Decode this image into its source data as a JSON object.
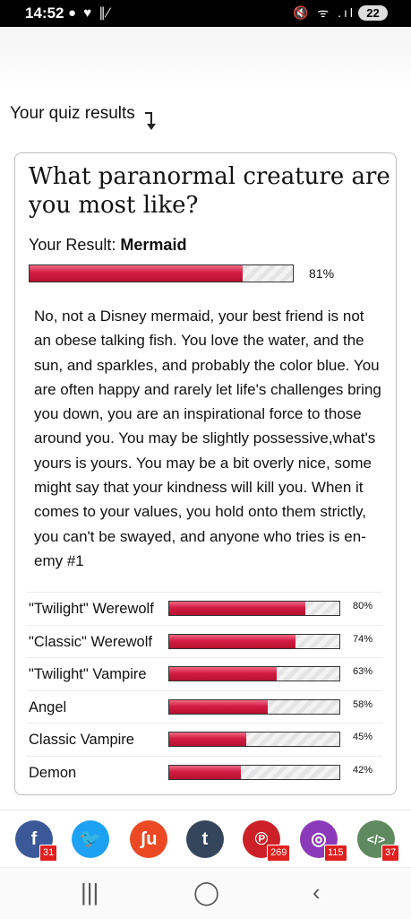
{
  "status": {
    "time": "14:52",
    "left_icons": "● ♥ ∥∕",
    "right_icons": "🔇 ᯤ .ıl",
    "battery": "22"
  },
  "page": {
    "results_label": "Your quiz results"
  },
  "quiz": {
    "title": "What paranormal creature are you most like?",
    "result_prefix": "Your Result:",
    "result_name": "Mermaid",
    "result_percent_text": "81%",
    "result_percent": 81,
    "description": "No, not a Disney mermaid, your best friend is not an obese talking fish. You love the water, and the sun, and sparkles, and probably the color blue. You are often happy and rarely let life's challenges bring you down, you are an inspirational force to those around you. You may be slightly possessive,what's yours is yours. You may be a bit overly nice, some might say that your kindness will kill you. When it comes to your values, you hold onto them strictly, you can't be swayed, and anyone who tries is en-emy #1",
    "other_results": [
      {
        "name": "\"Twilight\" Werewolf",
        "percent_text": "80%",
        "percent": 80
      },
      {
        "name": "\"Classic\" Werewolf",
        "percent_text": "74%",
        "percent": 74
      },
      {
        "name": "\"Twilight\" Vampire",
        "percent_text": "63%",
        "percent": 63
      },
      {
        "name": "Angel",
        "percent_text": "58%",
        "percent": 58
      },
      {
        "name": "Classic Vampire",
        "percent_text": "45%",
        "percent": 45
      },
      {
        "name": "Demon",
        "percent_text": "42%",
        "percent": 42
      }
    ]
  },
  "share": [
    {
      "icon": "facebook-icon",
      "glyph": "f",
      "color": "#3b5998",
      "count": "31"
    },
    {
      "icon": "twitter-icon",
      "glyph": "🐦",
      "color": "#1da1f2",
      "count": ""
    },
    {
      "icon": "stumbleupon-icon",
      "glyph": "ʃu",
      "color": "#eb4924",
      "count": ""
    },
    {
      "icon": "tumblr-icon",
      "glyph": "t",
      "color": "#35465c",
      "count": ""
    },
    {
      "icon": "pinterest-icon",
      "glyph": "℗",
      "color": "#cb2027",
      "count": "269"
    },
    {
      "icon": "instagram-icon",
      "glyph": "◎",
      "color": "#8a3ab9",
      "count": "115"
    },
    {
      "icon": "embed-icon",
      "glyph": "</>",
      "color": "#5f8a5f",
      "count": "37"
    }
  ],
  "nav": {
    "recents": "|||",
    "home": "◯",
    "back": "‹"
  }
}
